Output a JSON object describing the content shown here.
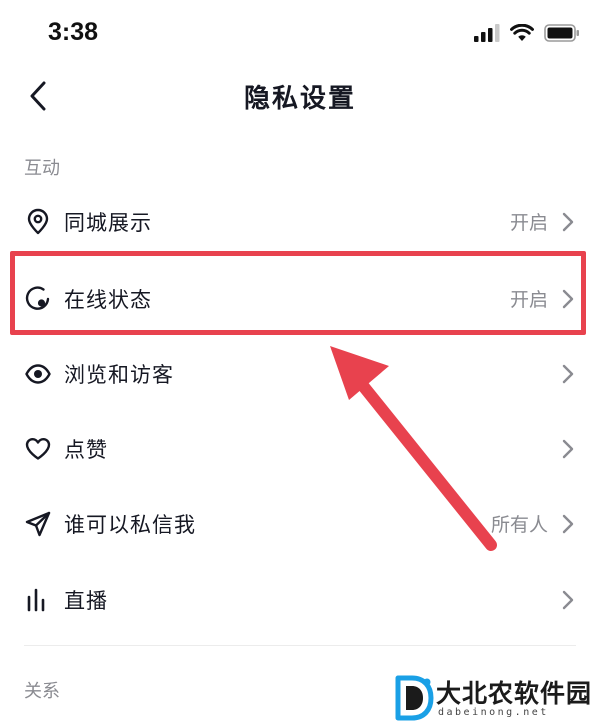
{
  "status_bar": {
    "time": "3:38"
  },
  "nav": {
    "title": "隐私设置"
  },
  "sections": [
    {
      "title": "互动"
    },
    {
      "title": "关系"
    }
  ],
  "rows": [
    {
      "label": "同城展示",
      "value": "开启",
      "icon": "location-pin-icon"
    },
    {
      "label": "在线状态",
      "value": "开启",
      "icon": "online-status-icon"
    },
    {
      "label": "浏览和访客",
      "value": "",
      "icon": "eye-icon"
    },
    {
      "label": "点赞",
      "value": "",
      "icon": "heart-icon"
    },
    {
      "label": "谁可以私信我",
      "value": "所有人",
      "icon": "send-icon"
    },
    {
      "label": "直播",
      "value": "",
      "icon": "live-bars-icon"
    }
  ],
  "annotation": {
    "highlight_color": "#e8424e",
    "highlighted_row": "在线状态"
  },
  "watermark": {
    "name": "大北农软件园",
    "url": "dabeinong.net",
    "accent": "#1aa0e6"
  }
}
